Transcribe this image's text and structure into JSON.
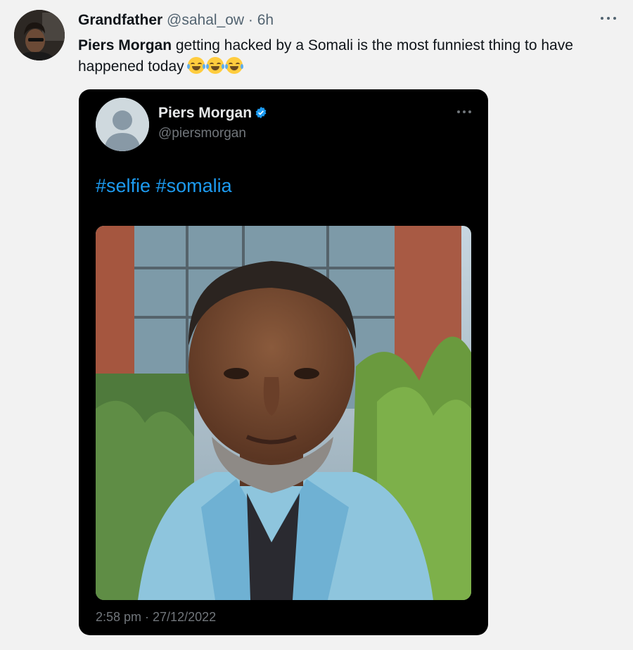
{
  "tweet": {
    "author_name": "Grandfather",
    "author_handle": "@sahal_ow",
    "separator": " · ",
    "time": "6h",
    "text_bold": "Piers Morgan",
    "text_rest": " getting hacked by a Somali is the most funniest thing to have happened today",
    "emoji": "face-with-tears-of-joy",
    "emoji_count": 3
  },
  "quoted": {
    "name": "Piers Morgan",
    "handle": "@piersmorgan",
    "text": "#selfie #somalia",
    "timestamp": "2:58 pm · 27/12/2022",
    "verified_color": "#1d9bf0",
    "hashtag_color": "#1d9bf0"
  }
}
